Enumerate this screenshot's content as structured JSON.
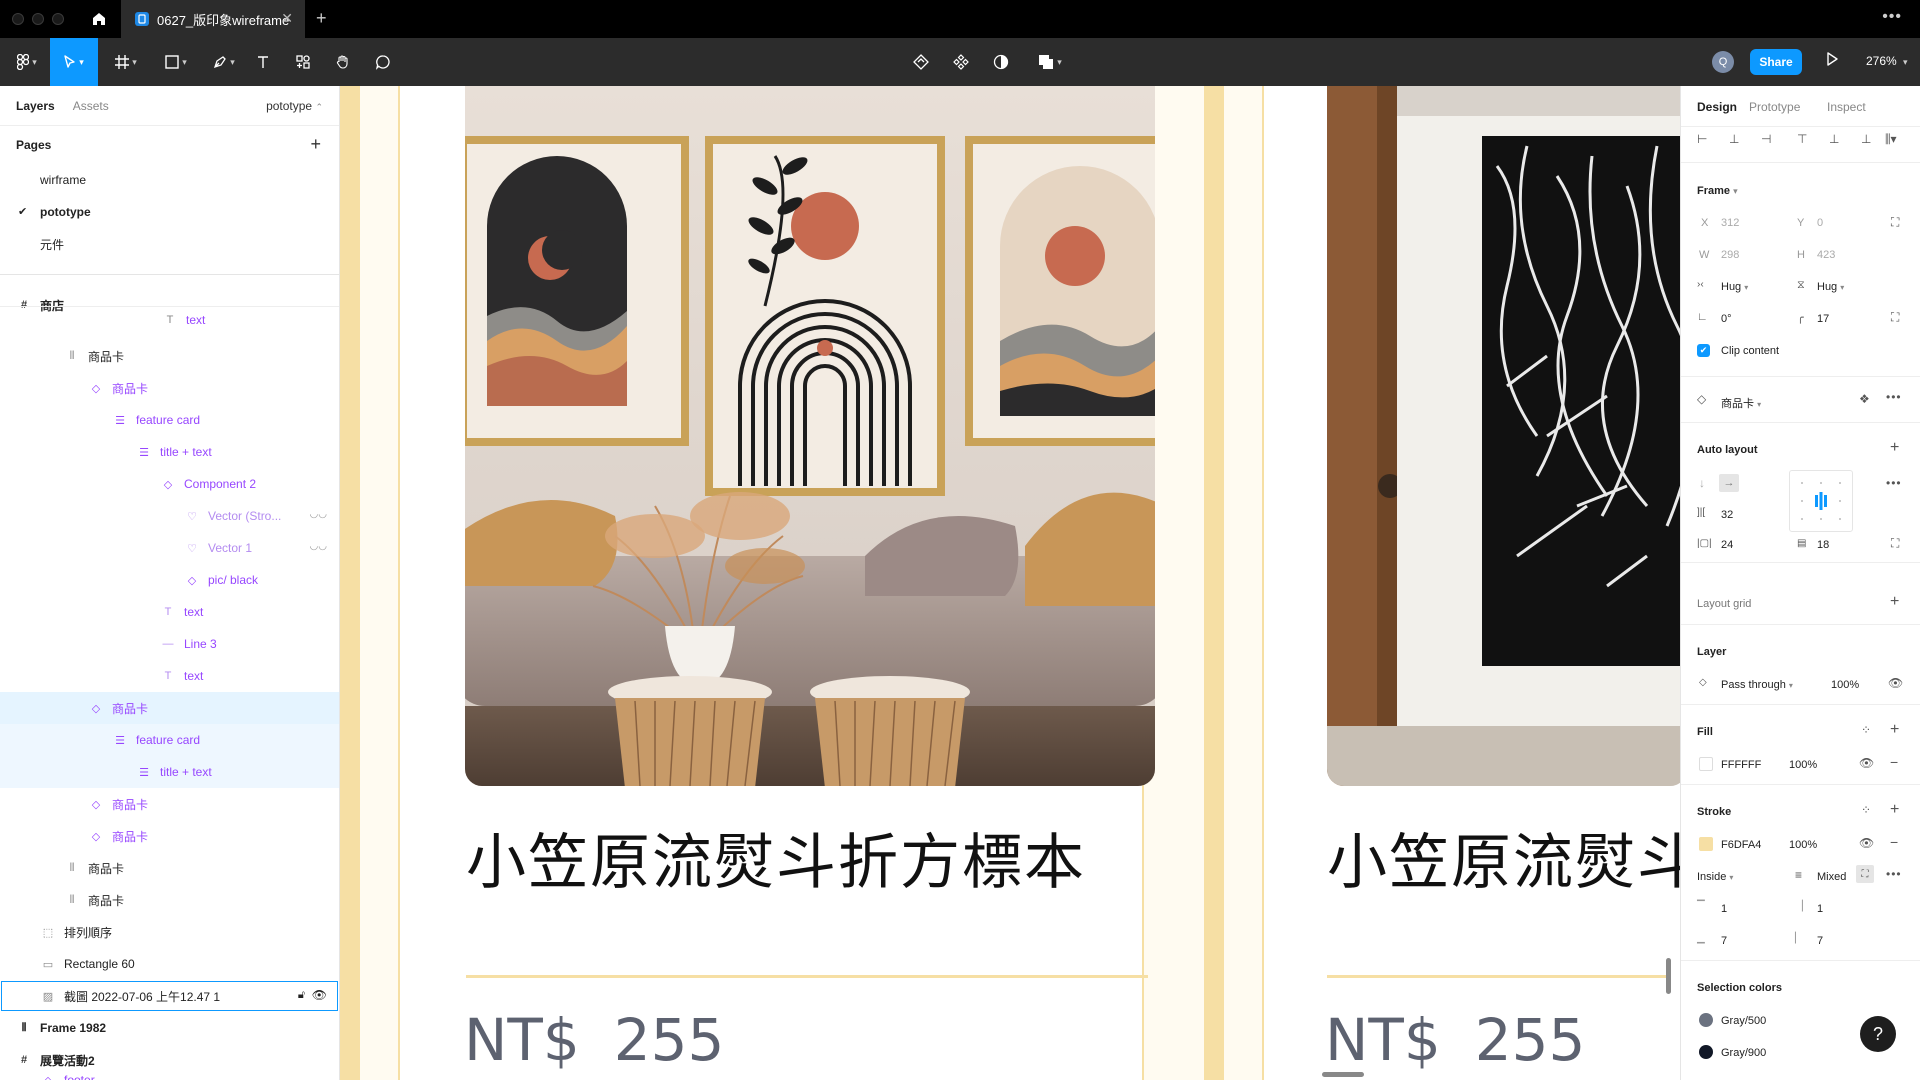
{
  "titlebar": {
    "file_tab_title": "0627_版印象wireframe"
  },
  "toolbar": {
    "user_initial": "Q",
    "share_label": "Share",
    "zoom": "276%"
  },
  "left_panel": {
    "tabs": {
      "layers": "Layers",
      "assets": "Assets"
    },
    "current_page": "pototype",
    "pages_title": "Pages",
    "pages": [
      "wirframe",
      "pototype",
      "元件"
    ],
    "layers": [
      {
        "label": "商店",
        "kind": "frame"
      },
      {
        "label": "text",
        "kind": "text"
      },
      {
        "label": "商品卡",
        "kind": "autolayout"
      },
      {
        "label": "商品卡",
        "kind": "instance"
      },
      {
        "label": "feature card",
        "kind": "autolayout-v"
      },
      {
        "label": "title + text",
        "kind": "autolayout-v"
      },
      {
        "label": "Component 2",
        "kind": "instance"
      },
      {
        "label": "Vector (Stro...",
        "kind": "vector"
      },
      {
        "label": "Vector 1",
        "kind": "vector"
      },
      {
        "label": "pic/ black",
        "kind": "instance"
      },
      {
        "label": "text",
        "kind": "text"
      },
      {
        "label": "Line 3",
        "kind": "line"
      },
      {
        "label": "text",
        "kind": "text"
      },
      {
        "label": "商品卡",
        "kind": "instance"
      },
      {
        "label": "feature card",
        "kind": "autolayout-v"
      },
      {
        "label": "title + text",
        "kind": "autolayout-v"
      },
      {
        "label": "商品卡",
        "kind": "instance"
      },
      {
        "label": "商品卡",
        "kind": "instance"
      },
      {
        "label": "商品卡",
        "kind": "autolayout"
      },
      {
        "label": "商品卡",
        "kind": "autolayout"
      },
      {
        "label": "排列順序",
        "kind": "group"
      },
      {
        "label": "Rectangle 60",
        "kind": "rect"
      },
      {
        "label": "截圖 2022-07-06 上午12.47 1",
        "kind": "image"
      },
      {
        "label": "Frame 1982",
        "kind": "autolayout"
      },
      {
        "label": "展覽活動2",
        "kind": "frame"
      },
      {
        "label": "footer",
        "kind": "instance"
      }
    ]
  },
  "canvas": {
    "cards": [
      {
        "title": "小笠原流熨斗折方標本",
        "currency": "NT$",
        "price": "255"
      },
      {
        "title": "小笠原流熨斗",
        "currency": "NT$",
        "price": "255"
      }
    ],
    "colors": {
      "accent": "#F6DFA4",
      "background": "#FFFBF1"
    }
  },
  "right_panel": {
    "tabs": {
      "design": "Design",
      "prototype": "Prototype",
      "inspect": "Inspect"
    },
    "frame": {
      "title": "Frame",
      "x_label": "X",
      "x": "312",
      "y_label": "Y",
      "y": "0",
      "w_label": "W",
      "w": "298",
      "h_label": "H",
      "h": "423",
      "hug_w": "Hug",
      "hug_h": "Hug",
      "rotation": "0°",
      "radius": "17",
      "clip_content": "Clip content"
    },
    "component_name": "商品卡",
    "auto_layout": {
      "title": "Auto layout",
      "spacing": "32",
      "padding_h": "24",
      "padding_v": "18"
    },
    "layout_grid_title": "Layout grid",
    "layer": {
      "title": "Layer",
      "blend": "Pass through",
      "opacity": "100%"
    },
    "fill": {
      "title": "Fill",
      "hex": "FFFFFF",
      "opacity": "100%",
      "color": "#FFFFFF"
    },
    "stroke": {
      "title": "Stroke",
      "hex": "F6DFA4",
      "opacity": "100%",
      "color": "#F6DFA4",
      "position": "Inside",
      "weight": "Mixed",
      "top": "1",
      "right": "1",
      "bottom": "7",
      "left": "7"
    },
    "selection_colors": {
      "title": "Selection colors",
      "items": [
        {
          "name": "Gray/500",
          "color": "#6B7280"
        },
        {
          "name": "Gray/900",
          "color": "#111827"
        }
      ]
    },
    "help": "?"
  }
}
